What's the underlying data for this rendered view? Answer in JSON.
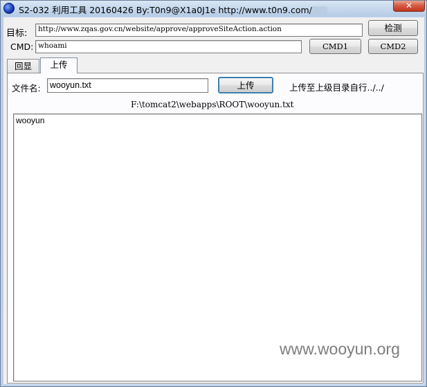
{
  "window": {
    "title": "S2-032 利用工具 20160426  By:T0n9@X1a0J1e   http://www.t0n9.com/",
    "close_label": "✕"
  },
  "form": {
    "target_label": "目标:",
    "target_value": "http://www.zqas.gov.cn/website/approve/approveSiteAction.action",
    "cmd_label": "CMD:",
    "cmd_value": "whoami",
    "detect_button": "检测",
    "cmd1_button": "CMD1",
    "cmd2_button": "CMD2"
  },
  "tabs": [
    {
      "label": "回显",
      "active": false
    },
    {
      "label": "上传",
      "active": true
    }
  ],
  "upload": {
    "filename_label": "文件名:",
    "filename_value": "wooyun.txt",
    "upload_button": "上传",
    "hint": "上传至上级目录自行../../",
    "path": "F:\\tomcat2\\webapps\\ROOT\\wooyun.txt",
    "output": "wooyun"
  },
  "watermark": "www.wooyun.org"
}
